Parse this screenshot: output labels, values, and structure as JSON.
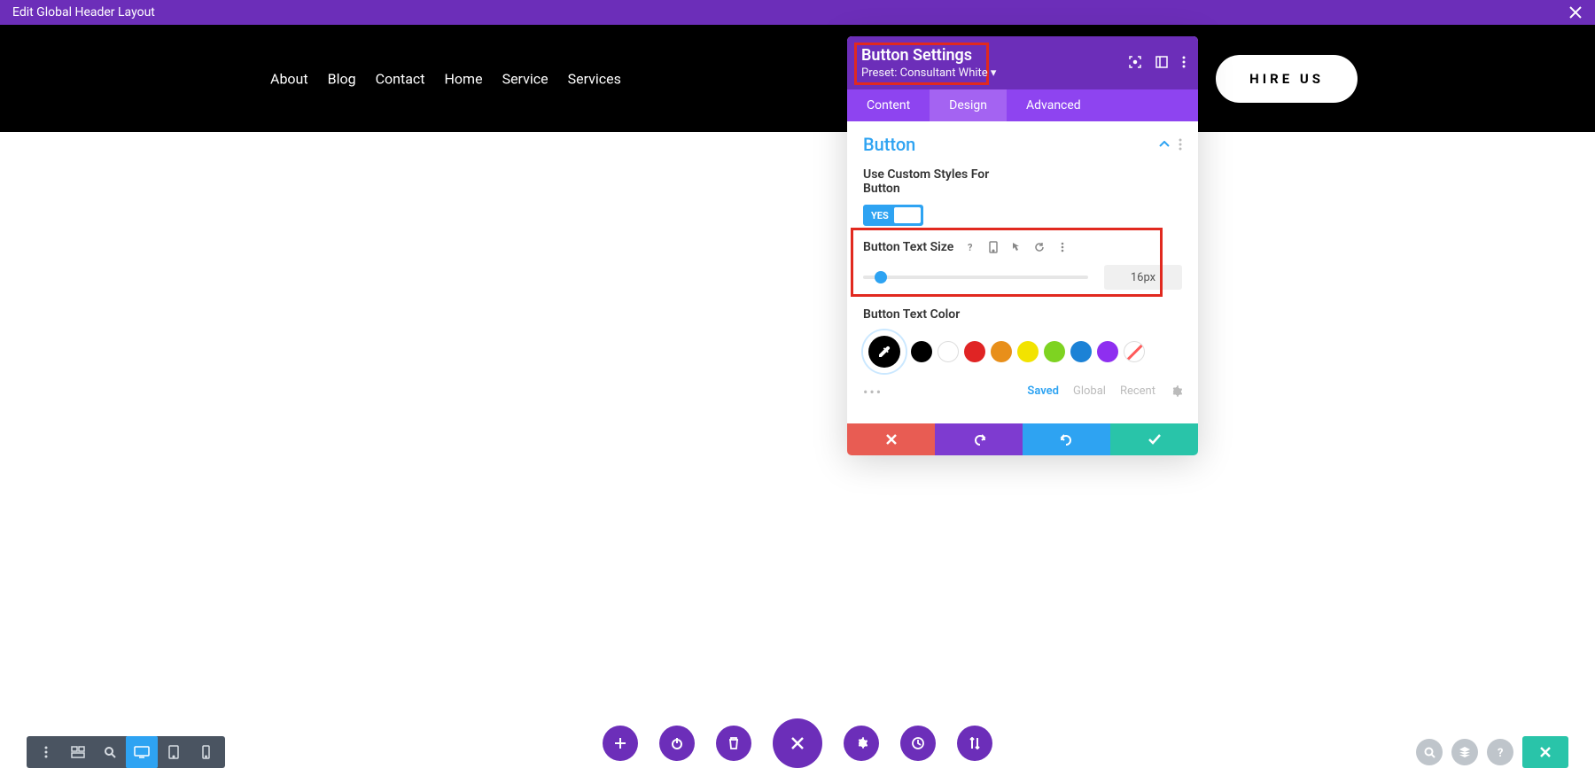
{
  "topbar": {
    "title": "Edit Global Header Layout"
  },
  "nav": {
    "items": [
      "About",
      "Blog",
      "Contact",
      "Home",
      "Service",
      "Services"
    ]
  },
  "hire_button": "HIRE US",
  "panel": {
    "title": "Button Settings",
    "preset": "Preset: Consultant White ▾",
    "tabs": [
      "Content",
      "Design",
      "Advanced"
    ],
    "active_tab": 1,
    "section": "Button",
    "custom_styles_label": "Use Custom Styles For Button",
    "toggle_yes": "YES",
    "text_size_label": "Button Text Size",
    "text_size_value": "16px",
    "text_color_label": "Button Text Color",
    "swatches": [
      "#000000",
      "#ffffff",
      "#e02424",
      "#e88f1a",
      "#f2e300",
      "#7ed321",
      "#1c82d6",
      "#8e2ff0"
    ],
    "color_tabs": {
      "saved": "Saved",
      "global": "Global",
      "recent": "Recent"
    }
  }
}
